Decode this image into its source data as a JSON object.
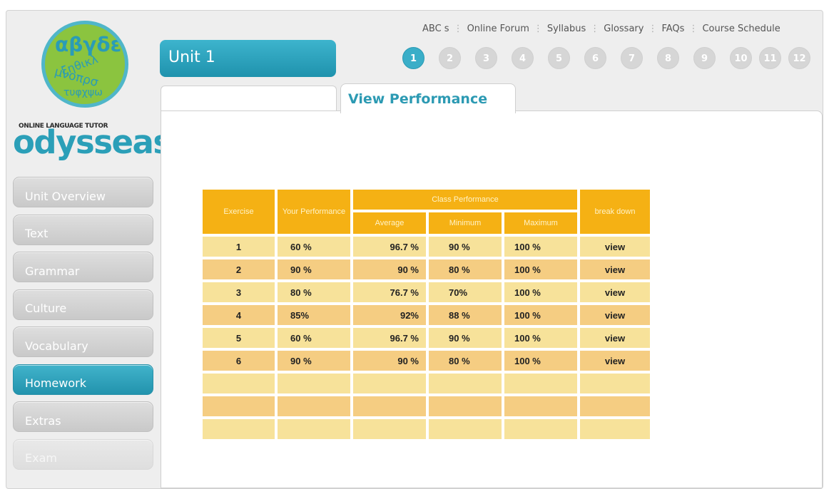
{
  "brand": {
    "tagline": "ONLINE LANGUAGE TUTOR",
    "wordmark": "odysseas",
    "logo_letters": "αβγδε",
    "colors": {
      "accent": "#2b9fb8",
      "logo_green": "#8bc43f"
    }
  },
  "top_links": [
    "ABC s",
    "Online Forum",
    "Syllabus",
    "Glossary",
    "FAQs",
    "Course Schedule"
  ],
  "unit_title": "Unit 1",
  "unit_numbers": [
    "1",
    "2",
    "3",
    "4",
    "5",
    "6",
    "7",
    "8",
    "9",
    "10",
    "11",
    "12"
  ],
  "active_unit": "1",
  "tabs": {
    "active_label": "View Performance"
  },
  "sidebar": {
    "items": [
      {
        "label": "Unit Overview",
        "state": "normal"
      },
      {
        "label": "Text",
        "state": "normal"
      },
      {
        "label": "Grammar",
        "state": "normal"
      },
      {
        "label": "Culture",
        "state": "normal"
      },
      {
        "label": "Vocabulary",
        "state": "normal"
      },
      {
        "label": "Homework",
        "state": "active"
      },
      {
        "label": "Extras",
        "state": "normal"
      },
      {
        "label": "Exam",
        "state": "disabled"
      }
    ]
  },
  "table": {
    "headers": {
      "exercise": "Exercise",
      "your_performance": "Your Performance",
      "class_performance": "Class Performance",
      "average": "Average",
      "minimum": "Minimum",
      "maximum": "Maximum",
      "breakdown": "break down"
    },
    "rows": [
      {
        "exercise": "1",
        "your": "60 %",
        "avg": "96.7 %",
        "min": "90 %",
        "max": "100 %",
        "link": "view"
      },
      {
        "exercise": "2",
        "your": "90 %",
        "avg": "90 %",
        "min": "80 %",
        "max": "100 %",
        "link": "view"
      },
      {
        "exercise": "3",
        "your": "80 %",
        "avg": "76.7 %",
        "min": "70%",
        "max": "100 %",
        "link": "view"
      },
      {
        "exercise": "4",
        "your": "85%",
        "avg": "92%",
        "min": "88 %",
        "max": "100 %",
        "link": "view"
      },
      {
        "exercise": "5",
        "your": "60 %",
        "avg": "96.7 %",
        "min": "90 %",
        "max": "100 %",
        "link": "view"
      },
      {
        "exercise": "6",
        "your": "90 %",
        "avg": "90 %",
        "min": "80 %",
        "max": "100 %",
        "link": "view"
      },
      {
        "exercise": "",
        "your": "",
        "avg": "",
        "min": "",
        "max": "",
        "link": ""
      },
      {
        "exercise": "",
        "your": "",
        "avg": "",
        "min": "",
        "max": "",
        "link": ""
      },
      {
        "exercise": "",
        "your": "",
        "avg": "",
        "min": "",
        "max": "",
        "link": ""
      }
    ]
  }
}
